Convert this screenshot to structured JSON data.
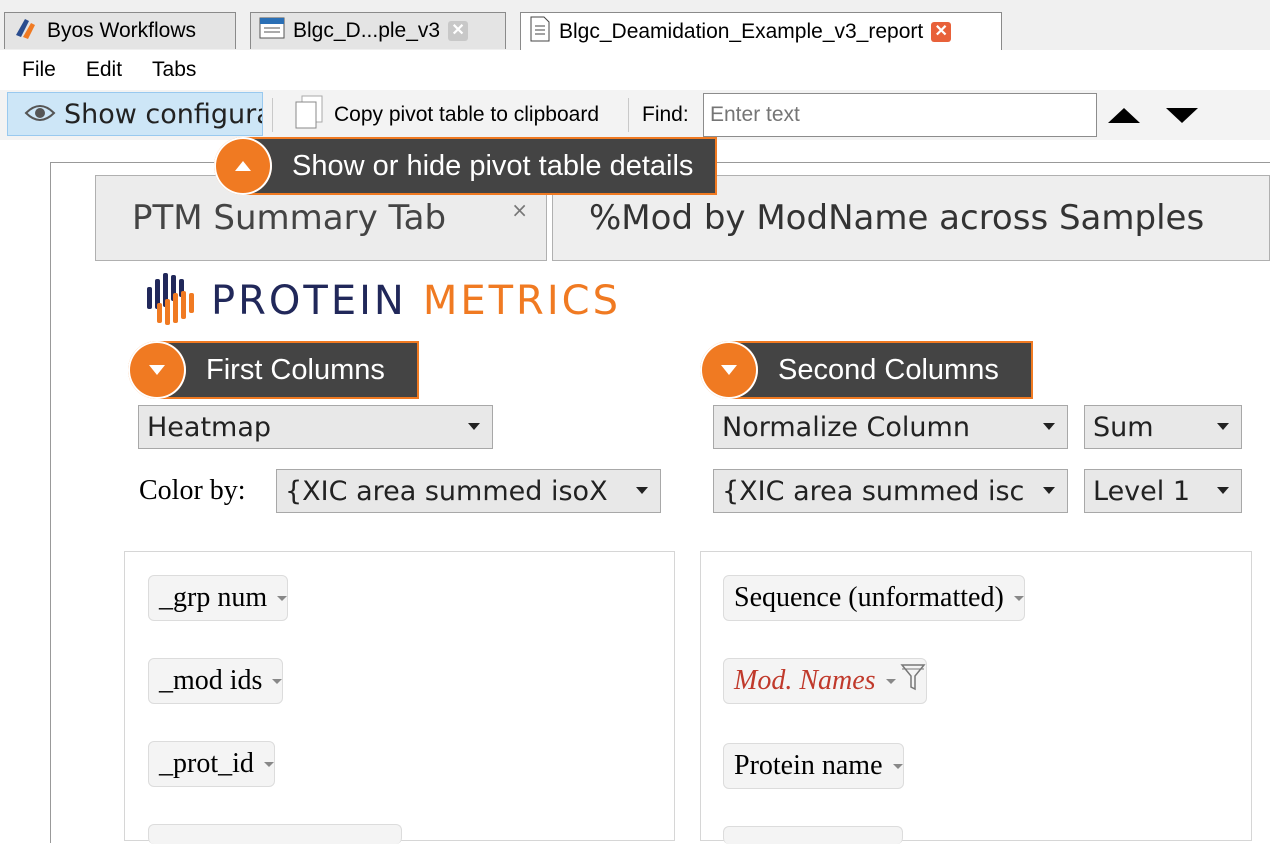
{
  "window_tabs": [
    {
      "label": "Byos Workflows",
      "closable": false
    },
    {
      "label": "Blgc_D...ple_v3",
      "closable": true
    },
    {
      "label": "Blgc_Deamidation_Example_v3_report",
      "closable": true,
      "active": true
    }
  ],
  "menu": [
    "File",
    "Edit",
    "Tabs"
  ],
  "toolbar": {
    "show_config": "Show configuration",
    "copy_pivot": "Copy pivot table to clipboard",
    "find_label": "Find:",
    "find_placeholder": "Enter text"
  },
  "details_toggle": {
    "label": "Show or hide pivot table details"
  },
  "report_tabs": [
    {
      "label": "PTM Summary Tab",
      "close": "×"
    },
    {
      "label": "%Mod by ModName across Samples"
    }
  ],
  "logo": {
    "word1": "PROTEIN",
    "word2": "METRICS",
    "color1": "#21285a",
    "color2": "#f07a22"
  },
  "first_columns": {
    "header": "First Columns",
    "renderer": "Heatmap",
    "color_by_label": "Color by:",
    "color_by_value": "{XIC area summed isoX",
    "fields": [
      "_grp num",
      "_mod ids",
      "_prot_id"
    ]
  },
  "second_columns": {
    "header": "Second Columns",
    "normalize": "Normalize Column",
    "aggregate": "Sum",
    "value": "{XIC area summed isc",
    "level": "Level 1",
    "fields": [
      {
        "label": "Sequence (unformatted)",
        "filtered": false
      },
      {
        "label": "Mod. Names",
        "filtered": true
      },
      {
        "label": "Protein name",
        "filtered": false
      }
    ]
  },
  "colors": {
    "accent": "#f07a22",
    "header_bg": "#444444",
    "selected_btn": "#cde6f7"
  }
}
